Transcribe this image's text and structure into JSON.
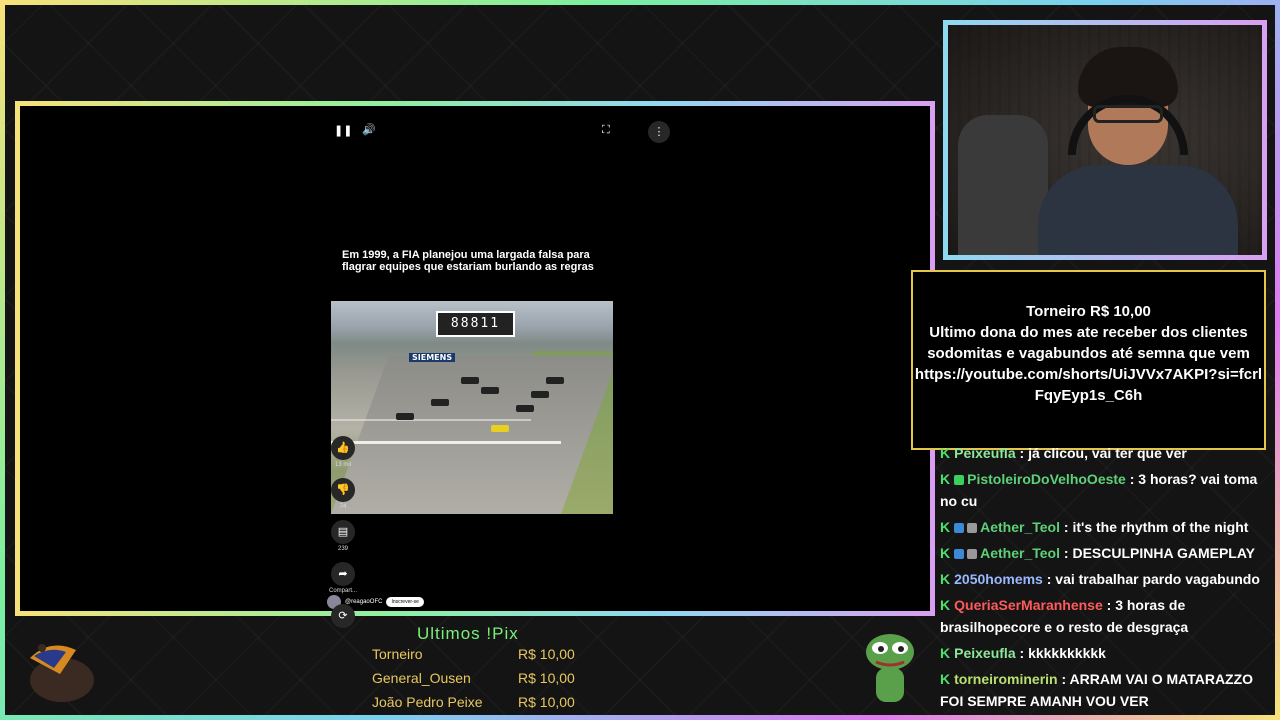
{
  "chat_top_partial": "",
  "short": {
    "caption": "Em 1999, a FIA planejou uma largada falsa para flagrar equipes que estariam burlando as regras",
    "sign_text": "88811",
    "brand_text": "SIEMENS",
    "likes": "13 mil",
    "dislikes": "74",
    "comments": "239",
    "share": "Compart...",
    "channel": "@reagaoOFC",
    "subscribe": "Inscrever-se"
  },
  "tourney": {
    "title": "Torneiro R$ 10,00",
    "line1": "Ultimo dona do mes ate receber dos clientes sodomitas e vagabundos até semna que vem",
    "link": "https://youtube.com/shorts/UiJVVx7AKPI?si=fcrlFqyEyp1s_C6h"
  },
  "chat": [
    {
      "user": "Peixeufla",
      "text": "já clicou, vai ter que ver",
      "color": "#8ee89a",
      "badges": []
    },
    {
      "user": "PistoleiroDoVelhoOeste",
      "text": "3 horas? vai toma no cu",
      "color": "#5ed07a",
      "badges": [
        "#3ad060"
      ]
    },
    {
      "user": "Aether_Teol",
      "text": "it's the rhythm of the night",
      "color": "#5ed07a",
      "badges": [
        "#3a8ad8",
        "#999999"
      ]
    },
    {
      "user": "Aether_Teol",
      "text": "DESCULPINHA GAMEPLAY",
      "color": "#5ed07a",
      "badges": [
        "#3a8ad8",
        "#999999"
      ]
    },
    {
      "user": "2050homems",
      "text": "vai trabalhar pardo vagabundo",
      "color": "#9ab8ff",
      "badges": []
    },
    {
      "user": "QueriaSerMaranhense",
      "text": "3 horas de brasilhopecore e o resto de desgraça",
      "color": "#ff5a5a",
      "badges": []
    },
    {
      "user": "Peixeufla",
      "text": "kkkkkkkkkk",
      "color": "#8ee89a",
      "badges": []
    },
    {
      "user": "torneirominerin",
      "text": "ARRAM VAI O MATARAZZO FOI SEMPRE AMANH VOU VER",
      "color": "#b8e070",
      "badges": []
    }
  ],
  "pix": {
    "title": "Ultimos !Pix",
    "rows": [
      {
        "name": "Torneiro",
        "value": "R$ 10,00"
      },
      {
        "name": "General_Ousen",
        "value": "R$ 10,00"
      },
      {
        "name": "João Pedro Peixe",
        "value": "R$ 10,00"
      }
    ]
  },
  "colors": {
    "accent_gold": "#e3c64a",
    "pix_green": "#7af07a",
    "chat_check": "#4ee06a"
  },
  "icons": {
    "pause": "pause-icon",
    "volume": "volume-icon",
    "fullscreen": "fullscreen-icon",
    "more": "more-vertical-icon",
    "like": "thumbs-up-icon",
    "dislike": "thumbs-down-icon",
    "comment": "comment-icon",
    "share": "share-icon",
    "remix": "remix-icon"
  }
}
